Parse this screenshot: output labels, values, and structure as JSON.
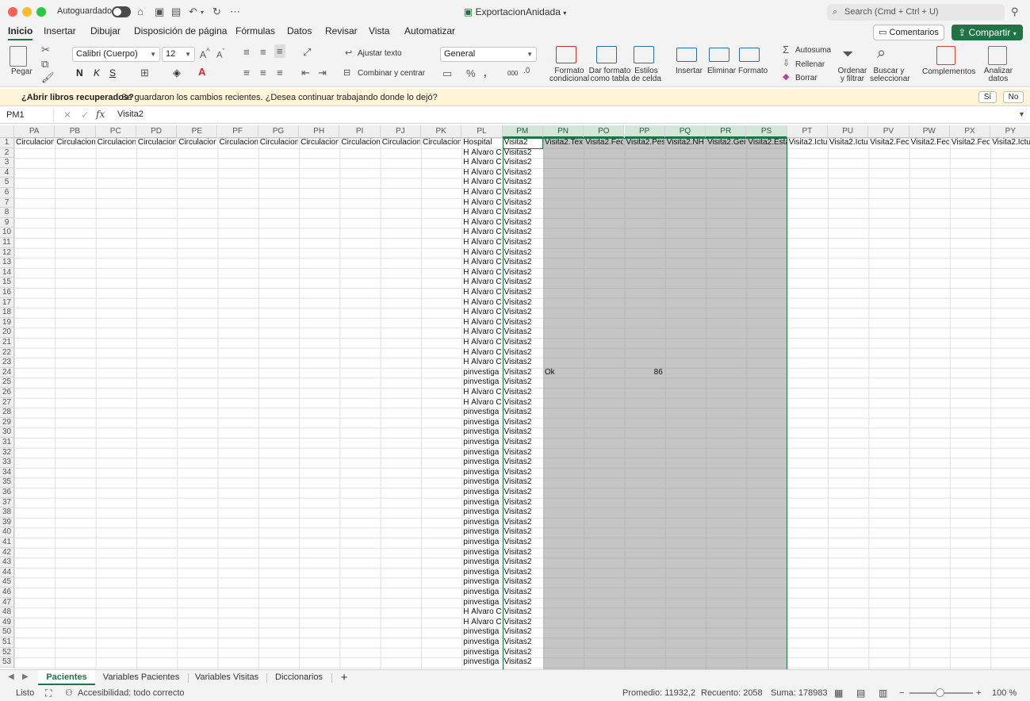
{
  "titlebar": {
    "autosave_label": "Autoguardado",
    "doc_title": "ExportacionAnidada",
    "search_placeholder": "Search (Cmd + Ctrl + U)"
  },
  "tabs": [
    "Inicio",
    "Insertar",
    "Dibujar",
    "Disposición de página",
    "Fórmulas",
    "Datos",
    "Revisar",
    "Vista",
    "Automatizar"
  ],
  "actions": {
    "comments": "Comentarios",
    "share": "Compartir"
  },
  "ribbon": {
    "paste": "Pegar",
    "font_name": "Calibri (Cuerpo)",
    "font_size": "12",
    "bold": "N",
    "italic": "K",
    "underline": "S",
    "wrap_text": "Ajustar texto",
    "merge_center": "Combinar y centrar",
    "number_format": "General",
    "percent": "%",
    "thousands": "000",
    "cond_format": [
      "Formato",
      "condicional"
    ],
    "format_table": [
      "Dar formato",
      "como tabla"
    ],
    "cell_styles": [
      "Estilos",
      "de celda"
    ],
    "insert": "Insertar",
    "delete": "Eliminar",
    "format": "Formato",
    "autosum": "Autosuma",
    "fill": "Rellenar",
    "clear": "Borrar",
    "sort_filter": [
      "Ordenar",
      "y filtrar"
    ],
    "find_select": [
      "Buscar y",
      "seleccionar"
    ],
    "addins": "Complementos",
    "analyze": [
      "Analizar",
      "datos"
    ]
  },
  "infobar": {
    "title": "¿Abrir libros recuperados?",
    "message": "Se guardaron los cambios recientes. ¿Desea continuar trabajando donde lo dejó?",
    "yes": "Sí",
    "no": "No"
  },
  "formula_bar": {
    "name_box": "PM1",
    "fx": "fx",
    "content": "Visita2"
  },
  "grid": {
    "columns": [
      "PA",
      "PB",
      "PC",
      "PD",
      "PE",
      "PF",
      "PG",
      "PH",
      "PI",
      "PJ",
      "PK",
      "PL",
      "PM",
      "PN",
      "PO",
      "PP",
      "PQ",
      "PR",
      "PS",
      "PT",
      "PU",
      "PV",
      "PW",
      "PX",
      "PY"
    ],
    "selected_columns": [
      "PM",
      "PN",
      "PO",
      "PP",
      "PQ",
      "PR",
      "PS"
    ],
    "row_count": 53,
    "header_row": [
      "CirculacionCo",
      "CirculacionCo",
      "CirculacionCo",
      "CirculacionCo",
      "CirculacionCo",
      "CirculacionCo",
      "CirculacionCo",
      "CirculacionCo",
      "CirculacionCo",
      "CirculacionCo",
      "CirculacionCo",
      "Hospital",
      "Visita2",
      "Visita2.Texto",
      "Visita2.Fecha",
      "Visita2.Peso",
      "Visita2.NH",
      "Visita2.Gene",
      "Visita2.Estado",
      "Visita2.Ictus",
      "Visita2.Ictus",
      "Visita2.Fecha",
      "Visita2.Fecha",
      "Visita2.Fecha",
      "Visita2.Ictus"
    ],
    "hospital_values": [
      "H Álvaro Cun",
      "H Álvaro Cun",
      "H Álvaro Cun",
      "H Álvaro Cun",
      "H Álvaro Cun",
      "H Álvaro Cun",
      "H Álvaro Cun",
      "H Álvaro Cun",
      "H Álvaro Cun",
      "H Álvaro Cun",
      "H Álvaro Cun",
      "H Álvaro Cun",
      "H Álvaro Cun",
      "H Álvaro Cun",
      "H Álvaro Cun",
      "H Álvaro Cun",
      "H Álvaro Cun",
      "H Álvaro Cun",
      "H Álvaro Cun",
      "H Álvaro Cun",
      "H Álvaro Cun",
      "H Álvaro Cun",
      "pinvestiga",
      "pinvestiga",
      "H Álvaro Cun",
      "H Álvaro Cun",
      "pinvestiga",
      "pinvestiga",
      "pinvestiga",
      "pinvestiga",
      "pinvestiga",
      "pinvestiga",
      "pinvestiga",
      "pinvestiga",
      "pinvestiga",
      "pinvestiga",
      "pinvestiga",
      "pinvestiga",
      "pinvestiga",
      "pinvestiga",
      "pinvestiga",
      "pinvestiga",
      "pinvestiga",
      "pinvestiga",
      "pinvestiga",
      "pinvestiga",
      "H Álvaro Cun",
      "H Álvaro Cun",
      "pinvestiga",
      "pinvestiga",
      "pinvestiga",
      "pinvestiga"
    ],
    "visita_value": "Visitas2",
    "row24": {
      "texto": "Ok",
      "peso": "86"
    }
  },
  "sheet_tabs": [
    "Pacientes",
    "Variables Pacientes",
    "Variables Visitas",
    "Diccionarios"
  ],
  "add_sheet": "+",
  "status": {
    "ready": "Listo",
    "accessibility": "Accesibilidad: todo correcto",
    "average": "Promedio: 11932,2",
    "count": "Recuento: 2058",
    "sum": "Suma: 178983",
    "zoom": "100 %"
  },
  "colors": {
    "accent": "#217346",
    "info_bg": "#fdf3d8",
    "selection": "#9a9a9a"
  }
}
